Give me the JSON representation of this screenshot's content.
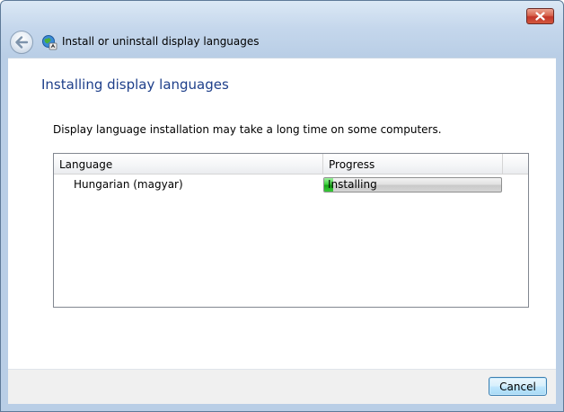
{
  "window": {
    "header_title": "Install or uninstall display languages"
  },
  "page": {
    "heading": "Installing display languages",
    "description": "Display language installation may take a long time on some computers."
  },
  "list": {
    "columns": [
      "Language",
      "Progress"
    ],
    "rows": [
      {
        "language": "Hungarian (magyar)",
        "status": "Installing",
        "progress_fraction": 0.05
      }
    ]
  },
  "footer": {
    "cancel_label": "Cancel"
  },
  "colors": {
    "heading": "#1e3f8a",
    "progress_fill": "#15a815",
    "close_button": "#c2352a"
  }
}
